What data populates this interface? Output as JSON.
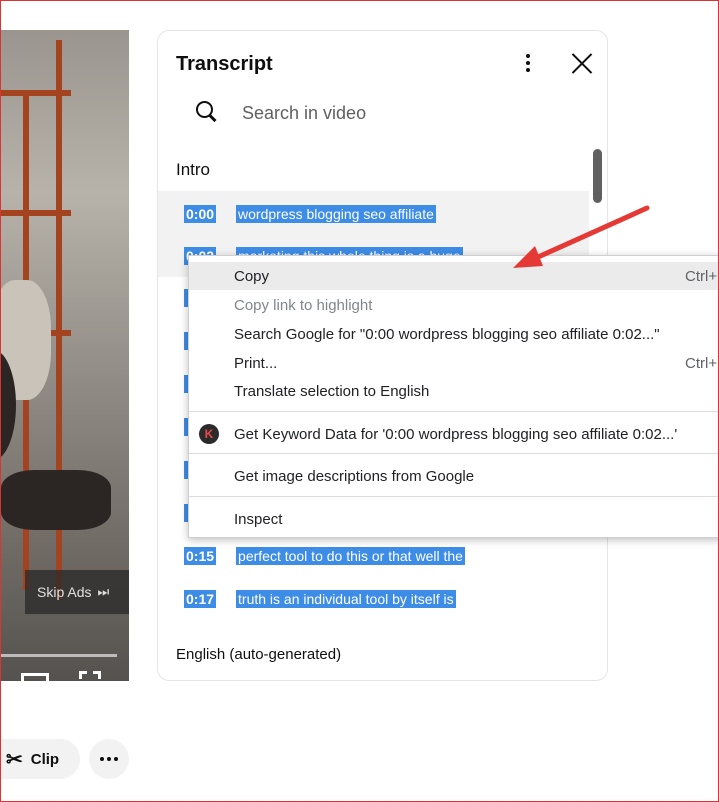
{
  "video": {
    "skip_ads_label": "Skip Ads",
    "skip_icon": "⏭",
    "progress_fraction": 0.96
  },
  "transcript": {
    "title": "Transcript",
    "search_placeholder": "Search in video",
    "section_label": "Intro",
    "segments": [
      {
        "time": "0:00",
        "text": "wordpress blogging seo affiliate"
      },
      {
        "time": "0:02",
        "text": "marketing this whole thing is a huge"
      },
      {
        "time": "0:15",
        "text": "perfect tool to do this or that well the"
      },
      {
        "time": "0:17",
        "text": "truth is an individual tool by itself is"
      }
    ],
    "language_label": "English (auto-generated)"
  },
  "context_menu": {
    "items": [
      {
        "label": "Copy",
        "shortcut": "Ctrl+"
      },
      {
        "label": "Copy link to highlight"
      },
      {
        "label": "Search Google for \"0:00 wordpress blogging seo affiliate 0:02...\""
      },
      {
        "label": "Print...",
        "shortcut": "Ctrl+"
      },
      {
        "label": "Translate selection to English"
      },
      {
        "label": "Get Keyword Data for '0:00 wordpress blogging seo affiliate 0:02...'",
        "icon_letter": "K"
      },
      {
        "label": "Get image descriptions from Google"
      },
      {
        "label": "Inspect"
      }
    ]
  },
  "actions": {
    "clip_label": "Clip"
  },
  "colors": {
    "selection": "#3d8ce6",
    "arrow": "#e53935",
    "frame_border": "#dd3333"
  }
}
